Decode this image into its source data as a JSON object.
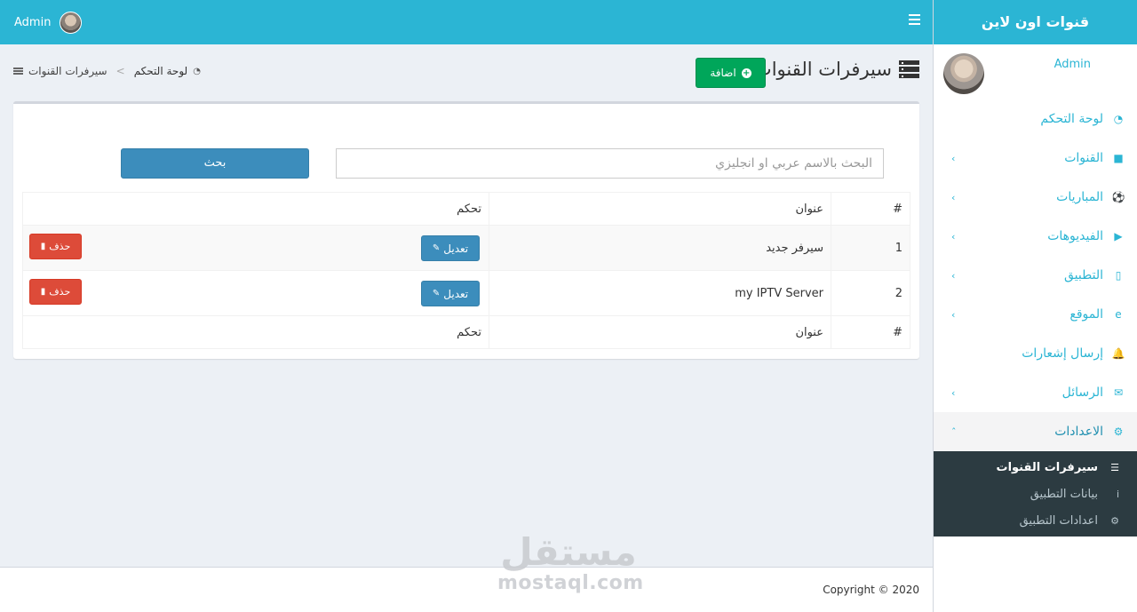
{
  "header": {
    "user_name": "Admin",
    "menu_icon": "bars-icon"
  },
  "sidebar": {
    "brand": "قنوات اون لاين",
    "user_name": "Admin",
    "items": [
      {
        "label": "لوحة التحكم",
        "icon": "dashboard-icon",
        "glyph": "◔",
        "has_children": false
      },
      {
        "label": "القنوات",
        "icon": "video-icon",
        "glyph": "■",
        "has_children": true
      },
      {
        "label": "المباريات",
        "icon": "soccer-ball-icon",
        "glyph": "⚽",
        "has_children": true
      },
      {
        "label": "الفيديوهات",
        "icon": "play-icon",
        "glyph": "▶",
        "has_children": true
      },
      {
        "label": "التطبيق",
        "icon": "mobile-icon",
        "glyph": "▯",
        "has_children": true
      },
      {
        "label": "الموقع",
        "icon": "internet-explorer-icon",
        "glyph": "e",
        "has_children": true
      },
      {
        "label": "إرسال إشعارات",
        "icon": "bell-icon",
        "glyph": "🔔",
        "has_children": false
      },
      {
        "label": "الرسائل",
        "icon": "envelope-icon",
        "glyph": "✉",
        "has_children": true
      },
      {
        "label": "الاعدادات",
        "icon": "cogs-icon",
        "glyph": "⚙",
        "has_children": true,
        "expanded": true
      }
    ],
    "subitems": [
      {
        "label": "سيرفرات القنوات",
        "icon": "server-icon",
        "glyph": "☰",
        "current": true
      },
      {
        "label": "بيانات التطبيق",
        "icon": "info-icon",
        "glyph": "i",
        "current": false
      },
      {
        "label": "اعدادات التطبيق",
        "icon": "gear-icon",
        "glyph": "⚙",
        "current": false
      }
    ]
  },
  "page": {
    "title": "سيرفرات القنوات",
    "add_button": "اضافة",
    "breadcrumb": {
      "home": "لوحة التحكم",
      "current": "سيرفرات القنوات"
    }
  },
  "search": {
    "placeholder": "البحث بالاسم عربي او انجليزي",
    "button": "بحث"
  },
  "table": {
    "headers": [
      "#",
      "عنوان",
      "تحكم"
    ],
    "rows": [
      {
        "id": "1",
        "title": "سيرفر جديد",
        "edit": "تعديل",
        "delete": "حذف"
      },
      {
        "id": "2",
        "title": "my IPTV Server",
        "edit": "تعديل",
        "delete": "حذف"
      }
    ]
  },
  "footer": {
    "copyright": "Copyright © 2020"
  },
  "watermark": {
    "arabic": "مستقل",
    "latin": "mostaql.com"
  },
  "colors": {
    "primary": "#2bb5d4",
    "success": "#00a65a",
    "info": "#3c8dbc",
    "danger": "#dd4b39",
    "sidebar_sub_bg": "#2c3b41"
  }
}
